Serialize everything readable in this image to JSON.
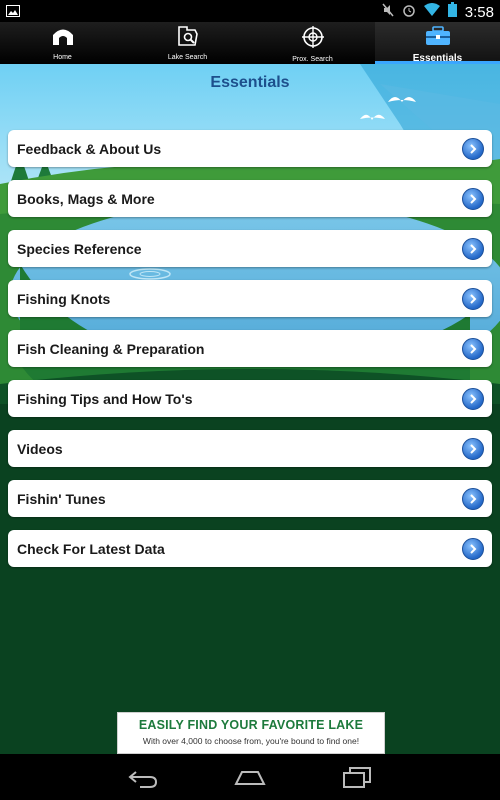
{
  "status_bar": {
    "time": "3:58",
    "icons": [
      "gallery-icon",
      "mute-icon",
      "alarm-icon",
      "wifi-icon",
      "battery-icon"
    ]
  },
  "tabs": [
    {
      "label": "Home",
      "icon": "home-icon",
      "active": false
    },
    {
      "label": "Lake Search",
      "icon": "lake-search-icon",
      "active": false
    },
    {
      "label": "Prox. Search",
      "icon": "crosshair-icon",
      "active": false
    },
    {
      "label": "Essentials",
      "icon": "toolbox-icon",
      "active": true
    }
  ],
  "page": {
    "title": "Essentials"
  },
  "menu": [
    {
      "label": "Feedback & About Us"
    },
    {
      "label": "Books, Mags & More"
    },
    {
      "label": "Species Reference"
    },
    {
      "label": "Fishing Knots"
    },
    {
      "label": "Fish Cleaning & Preparation"
    },
    {
      "label": "Fishing Tips and How To's"
    },
    {
      "label": "Videos"
    },
    {
      "label": "Fishin' Tunes"
    },
    {
      "label": "Check For Latest Data"
    }
  ],
  "ad": {
    "title": "EASILY FIND YOUR FAVORITE LAKE",
    "subtitle": "With over 4,000 to choose from, you're bound to find one!"
  },
  "nav_bar": {
    "buttons": [
      "back-icon",
      "home-icon",
      "recent-apps-icon"
    ]
  },
  "colors": {
    "accent": "#3aa6ff",
    "title": "#1d4f8c",
    "background": "#0a4220",
    "ad_title": "#1d7a3c"
  }
}
